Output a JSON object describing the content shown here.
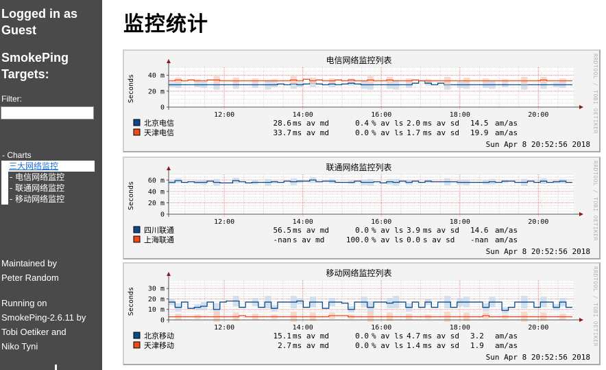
{
  "sidebar": {
    "login_title": "Logged in as Guest",
    "targets_title": "SmokePing Targets:",
    "filter_label": "Filter:",
    "filter_value": "",
    "charts_node": "- Charts",
    "tree": {
      "active": "三大网络监控",
      "children": [
        "- 电信网络监控",
        "- 联通网络监控",
        "- 移动网络监控"
      ]
    },
    "maintained_by": [
      "Maintained by",
      "Peter Random"
    ],
    "running_on": [
      "Running on",
      "SmokePing-2.6.11 by",
      "Tobi Oetiker and",
      "Niko Tyni"
    ]
  },
  "page": {
    "title": "监控统计"
  },
  "colors": {
    "series1": "#0b4a8b",
    "series2": "#f04a1a",
    "axis_arrow": "#8b1a1a",
    "grid_major": "#f08a8a",
    "grid_minor": "#d8d8d8",
    "watermark": "#b5b5b5"
  },
  "chart_data": [
    {
      "type": "line",
      "title": "电信网络监控列表",
      "ylabel": "Seconds",
      "yticks": [
        "0",
        "20 m",
        "40 m"
      ],
      "ylim": [
        0,
        0.05
      ],
      "xticks": [
        "12:00",
        "14:00",
        "16:00",
        "18:00",
        "20:00"
      ],
      "xlim": [
        "10:35",
        "20:52"
      ],
      "watermark": "RRDTOOL / TOBI OETIKER",
      "timestamp": "Sun Apr  8 20:52:56 2018",
      "series": [
        {
          "name": "北京电信",
          "color": "#0b4a8b",
          "median_ms": 28.6,
          "loss_pct": 0.4,
          "sd_ms": 2.0,
          "am_as": 14.5,
          "values_ms": [
            28,
            28,
            28,
            28,
            28,
            28,
            28,
            28,
            28,
            28,
            28,
            28,
            28,
            28,
            28,
            28,
            28,
            29,
            28,
            29,
            28,
            29,
            30,
            29,
            28,
            29,
            28,
            29,
            30,
            29,
            28,
            28,
            28,
            28,
            28,
            28,
            28,
            28,
            30,
            33,
            30,
            28,
            30,
            28,
            28,
            28,
            28,
            28,
            28,
            28,
            28,
            28,
            28,
            28,
            28,
            28,
            28,
            28,
            28,
            28,
            28,
            28,
            28
          ],
          "legend": {
            "md": "28.6 ms av md",
            "ls": "0.4 % av ls",
            "sd": "2.0 ms av sd",
            "amas": "14.5",
            "unit": "am/as"
          }
        },
        {
          "name": "天津电信",
          "color": "#f04a1a",
          "median_ms": 33.7,
          "loss_pct": 0.0,
          "sd_ms": 1.7,
          "am_as": 19.9,
          "values_ms": [
            33,
            34,
            33,
            34,
            33,
            33,
            34,
            34,
            33,
            33,
            33,
            33,
            33,
            33,
            33,
            33,
            33,
            33,
            33,
            34,
            33,
            35,
            33,
            34,
            33,
            33,
            34,
            33,
            34,
            33,
            33,
            34,
            33,
            33,
            34,
            33,
            33,
            33,
            34,
            33,
            33,
            33,
            33,
            33,
            33,
            33,
            33,
            33,
            33,
            33,
            33,
            33,
            33,
            33,
            33,
            33,
            33,
            33,
            34,
            33,
            33,
            33,
            33
          ],
          "legend": {
            "md": "33.7 ms av md",
            "ls": "0.0 % av ls",
            "sd": "1.7 ms av sd",
            "amas": "19.9",
            "unit": "am/as"
          }
        }
      ]
    },
    {
      "type": "line",
      "title": "联通网络监控列表",
      "ylabel": "Seconds",
      "yticks": [
        "0",
        "20 m",
        "40 m",
        "60 m"
      ],
      "ylim": [
        0,
        0.07
      ],
      "xticks": [
        "12:00",
        "14:00",
        "16:00",
        "18:00",
        "20:00"
      ],
      "xlim": [
        "10:35",
        "20:52"
      ],
      "watermark": "RRDTOOL / TOBI OETIKER",
      "timestamp": "Sun Apr  8 20:52:56 2018",
      "series": [
        {
          "name": "四川联通",
          "color": "#0b4a8b",
          "median_ms": 56.5,
          "loss_pct": 0.0,
          "sd_ms": 3.9,
          "am_as": 14.6,
          "values_ms": [
            56,
            59,
            56,
            57,
            56,
            56,
            58,
            56,
            55,
            55,
            59,
            57,
            55,
            56,
            56,
            56,
            57,
            56,
            58,
            57,
            58,
            58,
            60,
            57,
            58,
            58,
            56,
            56,
            56,
            58,
            56,
            56,
            57,
            55,
            57,
            56,
            58,
            56,
            58,
            56,
            58,
            57,
            57,
            57,
            57,
            56,
            56,
            56,
            56,
            56,
            57,
            56,
            58,
            58,
            56,
            56,
            58,
            56,
            58,
            56,
            57,
            58,
            56
          ],
          "legend": {
            "md": "56.5 ms av md",
            "ls": "0.0 % av ls",
            "sd": "3.9 ms av sd",
            "amas": "14.6",
            "unit": "am/as"
          }
        },
        {
          "name": "上海联通",
          "color": "#f04a1a",
          "median_ms": null,
          "loss_pct": 100.0,
          "sd_ms": 0.0,
          "am_as": null,
          "values_ms": [],
          "legend": {
            "md": "-nan  s av md",
            "ls": "100.0 % av ls",
            "sd": "0.0  s av sd",
            "amas": "-nan",
            "unit": "am/as"
          }
        }
      ]
    },
    {
      "type": "line",
      "title": "移动网络监控列表",
      "ylabel": "Seconds",
      "yticks": [
        "0",
        "10 m",
        "20 m",
        "30 m"
      ],
      "ylim": [
        0,
        0.038
      ],
      "xticks": [
        "12:00",
        "14:00",
        "16:00",
        "18:00",
        "20:00"
      ],
      "xlim": [
        "10:35",
        "20:52"
      ],
      "watermark": "RRDTOOL / TOBI OETIKER",
      "timestamp": "Sun Apr  8 20:52:56 2018",
      "series": [
        {
          "name": "北京移动",
          "color": "#0b4a8b",
          "median_ms": 15.1,
          "loss_pct": 0.0,
          "sd_ms": 4.7,
          "am_as": 3.2,
          "values_ms": [
            17,
            12,
            17,
            11,
            12,
            13,
            17,
            10,
            17,
            18,
            18,
            12,
            17,
            17,
            12,
            17,
            11,
            17,
            17,
            17,
            18,
            12,
            17,
            17,
            11,
            17,
            17,
            16,
            10,
            17,
            17,
            12,
            17,
            17,
            16,
            17,
            17,
            12,
            17,
            12,
            17,
            12,
            17,
            17,
            12,
            17,
            17,
            17,
            17,
            12,
            17,
            17,
            9,
            12,
            17,
            17,
            17,
            12,
            17,
            17,
            12,
            17,
            12
          ],
          "legend": {
            "md": "15.1 ms av md",
            "ls": "0.0 % av ls",
            "sd": "4.7 ms av sd",
            "amas": "3.2",
            "unit": "am/as"
          }
        },
        {
          "name": "天津移动",
          "color": "#f04a1a",
          "median_ms": 2.7,
          "loss_pct": 0.0,
          "sd_ms": 1.4,
          "am_as": 1.9,
          "values_ms": [
            3,
            3,
            3,
            3,
            3,
            3,
            3,
            3,
            3,
            3,
            3,
            4,
            3,
            3,
            3,
            3,
            3,
            3,
            3,
            3,
            3,
            3,
            3,
            3,
            3,
            4,
            4,
            4,
            3,
            3,
            3,
            3,
            3,
            3,
            3,
            3,
            3,
            3,
            3,
            3,
            3,
            3,
            3,
            3,
            3,
            3,
            3,
            3,
            3,
            4,
            3,
            3,
            3,
            3,
            3,
            3,
            3,
            3,
            3,
            3,
            3,
            3,
            3
          ],
          "legend": {
            "md": "2.7 ms av md",
            "ls": "0.0 % av ls",
            "sd": "1.4 ms av sd",
            "amas": "1.9",
            "unit": "am/as"
          }
        }
      ]
    }
  ]
}
